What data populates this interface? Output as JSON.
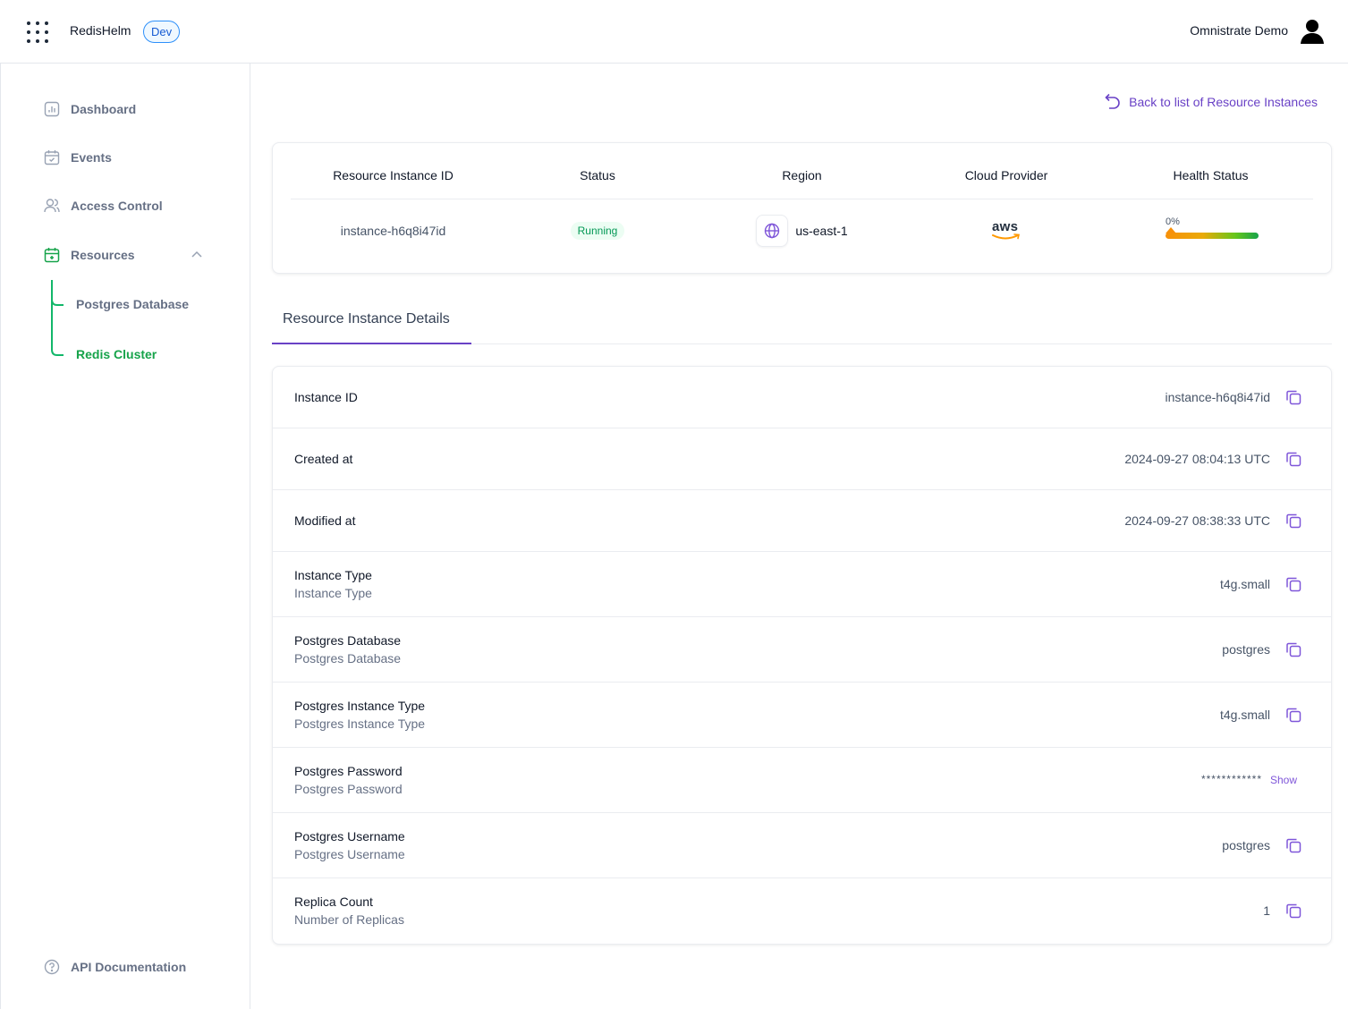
{
  "header": {
    "app_name": "RedisHelm",
    "env_badge": "Dev",
    "user_name": "Omnistrate Demo"
  },
  "sidebar": {
    "items": [
      {
        "label": "Dashboard",
        "icon": "chart-icon"
      },
      {
        "label": "Events",
        "icon": "calendar-check-icon"
      },
      {
        "label": "Access Control",
        "icon": "users-icon"
      },
      {
        "label": "Resources",
        "icon": "calendar-icon"
      }
    ],
    "resources_children": [
      {
        "label": "Postgres Database"
      },
      {
        "label": "Redis Cluster"
      }
    ],
    "api_documentation": "API Documentation",
    "colors": {
      "active": "#16a34a",
      "inactive": "#667085"
    }
  },
  "back_link": "Back to list of Resource Instances",
  "summary": {
    "headers": [
      "Resource Instance ID",
      "Status",
      "Region",
      "Cloud Provider",
      "Health Status"
    ],
    "instance_id": "instance-h6q8i47id",
    "status": "Running",
    "region": "us-east-1",
    "cloud_provider_logo": "aws",
    "health_percent": "0%",
    "health_value": 0
  },
  "tabs": {
    "active": "Resource Instance Details"
  },
  "details": {
    "instance_id": {
      "label": "Instance ID",
      "value": "instance-h6q8i47id"
    },
    "created_at": {
      "label": "Created at",
      "value": "2024-09-27 08:04:13 UTC"
    },
    "modified_at": {
      "label": "Modified at",
      "value": "2024-09-27 08:38:33 UTC"
    },
    "instance_type": {
      "label": "Instance Type",
      "sub": "Instance Type",
      "value": "t4g.small"
    },
    "postgres_database": {
      "label": "Postgres Database",
      "sub": "Postgres Database",
      "value": "postgres"
    },
    "postgres_instance_type": {
      "label": "Postgres Instance Type",
      "sub": "Postgres Instance Type",
      "value": "t4g.small"
    },
    "postgres_password": {
      "label": "Postgres Password",
      "sub": "Postgres Password",
      "masked": "************",
      "show_label": "Show"
    },
    "postgres_username": {
      "label": "Postgres Username",
      "sub": "Postgres Username",
      "value": "postgres"
    },
    "replica_count": {
      "label": "Replica Count",
      "sub": "Number of Replicas",
      "value": "1"
    }
  }
}
